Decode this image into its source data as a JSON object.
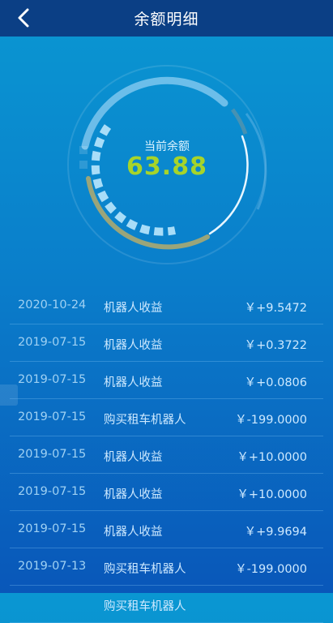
{
  "header": {
    "title": "余额明细",
    "back_icon": "chevron-left-icon"
  },
  "balance": {
    "label": "当前余额",
    "value": "63.88",
    "value_color": "#a6d42a"
  },
  "records": [
    {
      "date": "2020-10-24",
      "desc": "机器人收益",
      "amount": "￥+9.5472"
    },
    {
      "date": "2019-07-15",
      "desc": "机器人收益",
      "amount": "￥+0.3722"
    },
    {
      "date": "2019-07-15",
      "desc": "机器人收益",
      "amount": "￥+0.0806"
    },
    {
      "date": "2019-07-15",
      "desc": "购买租车机器人",
      "amount": "￥-199.0000"
    },
    {
      "date": "2019-07-15",
      "desc": "机器人收益",
      "amount": "￥+10.0000"
    },
    {
      "date": "2019-07-15",
      "desc": "机器人收益",
      "amount": "￥+10.0000"
    },
    {
      "date": "2019-07-15",
      "desc": "机器人收益",
      "amount": "￥+9.9694"
    },
    {
      "date": "2019-07-13",
      "desc": "购买租车机器人",
      "amount": "￥-199.0000"
    },
    {
      "date": "",
      "desc": "购买租车机器人",
      "amount": ""
    }
  ]
}
